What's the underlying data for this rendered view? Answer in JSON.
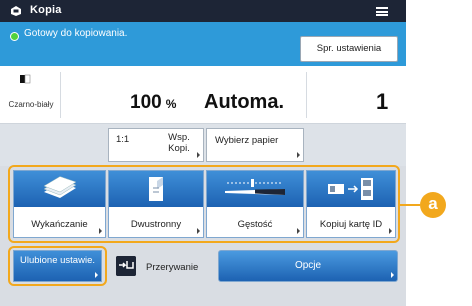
{
  "titlebar": {
    "title": "Kopia",
    "app_icon": "copy-app-icon",
    "menu_icon": "hamburger-menu-icon"
  },
  "status": {
    "text": "Gotowy do kopiowania.",
    "indicator_color": "#52d23c",
    "check_settings_label": "Spr. ustawienia"
  },
  "info": {
    "color_mode": "Czarno-biały",
    "zoom_value": "100",
    "zoom_unit": "%",
    "paper": "Automa.",
    "copies": "1"
  },
  "row2": {
    "ratio_main": "1:1",
    "ratio_sub": "Wsp. Kopi.",
    "select_paper": "Wybierz papier"
  },
  "tiles": [
    {
      "label": "Wykańczanie",
      "icon": "finishing-icon"
    },
    {
      "label": "Dwustronny",
      "icon": "two-sided-icon"
    },
    {
      "label": "Gęstość",
      "icon": "density-slider-icon"
    },
    {
      "label": "Kopiuj kartę ID",
      "icon": "id-card-copy-icon"
    }
  ],
  "bottom": {
    "favorites_label": "Ulubione ustawie.",
    "interrupt_label": "Przerywanie",
    "options_label": "Opcje"
  },
  "callout": {
    "letter": "a",
    "color": "#f2a81d"
  },
  "colors": {
    "titlebar": "#1d2536",
    "statusbar": "#2e9ad9",
    "accent_blue": "#1d62b2"
  }
}
